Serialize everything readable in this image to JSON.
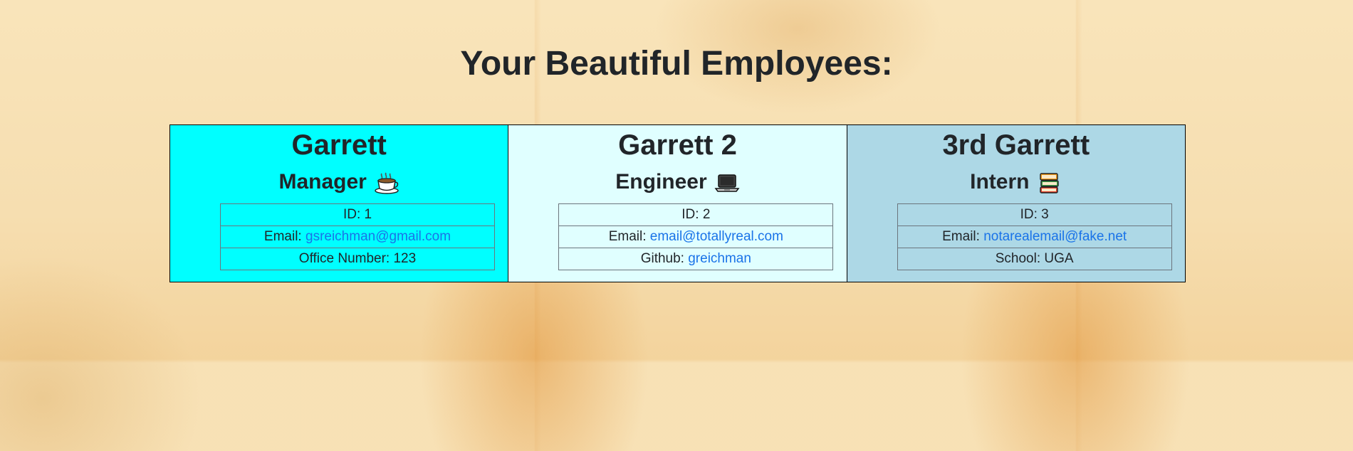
{
  "page": {
    "title": "Your Beautiful Employees:"
  },
  "colors": {
    "manager_card": "#00ffff",
    "engineer_card": "#e0ffff",
    "intern_card": "#add8e6",
    "link": "#1a73e8"
  },
  "employees": [
    {
      "name": "Garrett",
      "role": "Manager",
      "icon": "coffee-cup-icon",
      "id_text": "ID: 1",
      "email_label": "Email:",
      "email": "gsreichman@gmail.com",
      "extra_text": "Office Number: 123",
      "extra_label": "",
      "extra_value": ""
    },
    {
      "name": "Garrett 2",
      "role": "Engineer",
      "icon": "laptop-icon",
      "id_text": "ID: 2",
      "email_label": "Email:",
      "email": "email@totallyreal.com",
      "extra_text": "",
      "extra_label": "Github:",
      "extra_value": "greichman"
    },
    {
      "name": "3rd Garrett",
      "role": "Intern",
      "icon": "books-icon",
      "id_text": "ID: 3",
      "email_label": "Email:",
      "email": "notarealemail@fake.net",
      "extra_text": "School: UGA",
      "extra_label": "",
      "extra_value": ""
    }
  ]
}
